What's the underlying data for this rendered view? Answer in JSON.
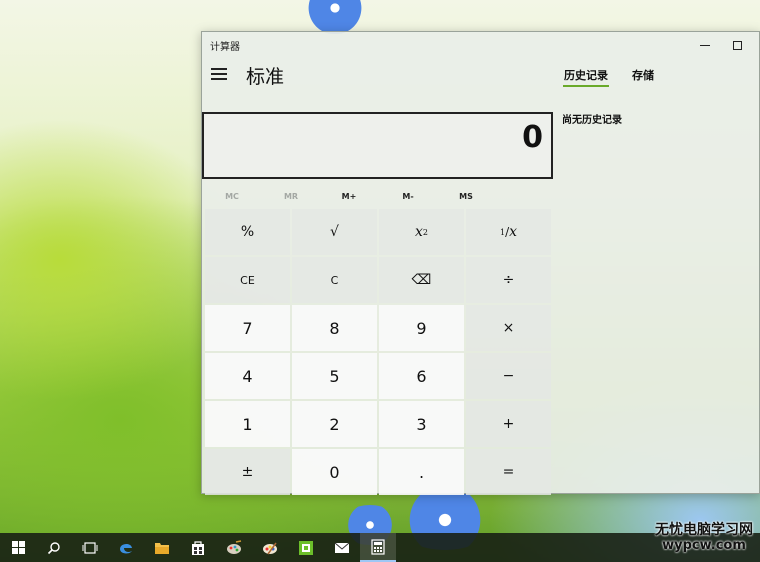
{
  "window": {
    "app_title": "计算器",
    "mode_title": "标准"
  },
  "tabs": [
    {
      "label": "历史记录",
      "active": true
    },
    {
      "label": "存储",
      "active": false
    }
  ],
  "history": {
    "empty_message": "尚无历史记录"
  },
  "display": {
    "value": "0"
  },
  "memory": [
    {
      "label": "MC",
      "enabled": false
    },
    {
      "label": "MR",
      "enabled": false
    },
    {
      "label": "M+",
      "enabled": true
    },
    {
      "label": "M-",
      "enabled": true
    },
    {
      "label": "MS",
      "enabled": true
    }
  ],
  "keys": {
    "percent": "%",
    "sqrt": "√",
    "square_base": "x",
    "square_exp": "2",
    "reciprocal_num": "1",
    "reciprocal_den": "x",
    "ce": "CE",
    "c": "C",
    "backspace": "⌫",
    "divide": "÷",
    "seven": "7",
    "eight": "8",
    "nine": "9",
    "multiply": "×",
    "four": "4",
    "five": "5",
    "six": "6",
    "minus": "−",
    "one": "1",
    "two": "2",
    "three": "3",
    "plus": "+",
    "negate": "±",
    "zero": "0",
    "decimal": ".",
    "equals": "="
  },
  "watermark": {
    "line1": "无忧电脑学习网",
    "line2": "wypcw.com"
  },
  "colors": {
    "accent": "#6aaa2a",
    "taskbar": "#18201a"
  }
}
